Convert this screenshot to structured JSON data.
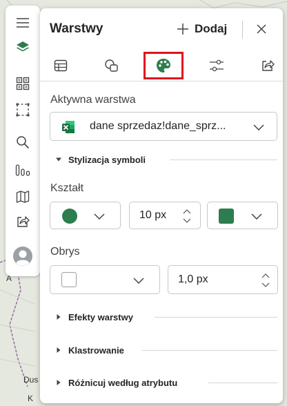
{
  "panel": {
    "title": "Warstwy",
    "add_label": "Dodaj"
  },
  "tabs": [
    {
      "icon": "table-icon",
      "active": false
    },
    {
      "icon": "shapes-icon",
      "active": false
    },
    {
      "icon": "palette-icon",
      "active": true
    },
    {
      "icon": "sliders-icon",
      "active": false
    },
    {
      "icon": "share-icon",
      "active": false
    }
  ],
  "active_layer": {
    "label": "Aktywna warstwa",
    "value": "dane sprzedaz!dane_sprz..."
  },
  "sections": {
    "symbol_styling": "Stylizacja symboli",
    "layer_effects": "Efekty warstwy",
    "clustering": "Klastrowanie",
    "vary_by_attribute": "Różnicuj według atrybutu"
  },
  "shape": {
    "label": "Kształt",
    "size_value": "10 px",
    "symbol_color": "#2e7d4f",
    "fill_color": "#2e7d4f"
  },
  "outline": {
    "label": "Obrys",
    "width_value": "1,0 px"
  },
  "map": {
    "labels": [
      "A",
      "Dus",
      "K"
    ]
  },
  "colors": {
    "accent": "#2e7d4f",
    "highlight_border": "#e0101f",
    "excel_green": "#1d6f42"
  }
}
